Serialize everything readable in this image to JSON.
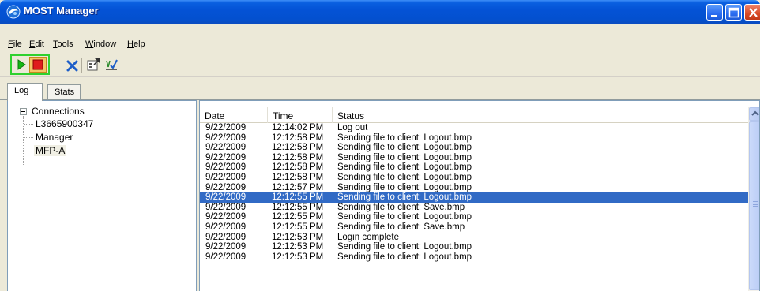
{
  "window": {
    "title": "MOST Manager"
  },
  "menu": [
    "File",
    "Edit",
    "Tools",
    "Window",
    "Help"
  ],
  "toolbar": {
    "icons": [
      "play-icon",
      "stop-icon",
      "delete-icon",
      "properties-icon",
      "checklist-icon"
    ]
  },
  "tabs": [
    {
      "label": "Log",
      "active": true
    },
    {
      "label": "Stats",
      "active": false
    }
  ],
  "tree": {
    "root": "Connections",
    "children": [
      "L3665900347",
      "Manager",
      "MFP-A"
    ]
  },
  "log": {
    "columns": [
      "Date",
      "Time",
      "Status"
    ],
    "rows": [
      {
        "date": "9/22/2009",
        "time": "12:14:02 PM",
        "status": "Log out"
      },
      {
        "date": "9/22/2009",
        "time": "12:12:58 PM",
        "status": "Sending file to client: Logout.bmp"
      },
      {
        "date": "9/22/2009",
        "time": "12:12:58 PM",
        "status": "Sending file to client: Logout.bmp"
      },
      {
        "date": "9/22/2009",
        "time": "12:12:58 PM",
        "status": "Sending file to client: Logout.bmp"
      },
      {
        "date": "9/22/2009",
        "time": "12:12:58 PM",
        "status": "Sending file to client: Logout.bmp"
      },
      {
        "date": "9/22/2009",
        "time": "12:12:58 PM",
        "status": "Sending file to client: Logout.bmp"
      },
      {
        "date": "9/22/2009",
        "time": "12:12:57 PM",
        "status": "Sending file to client: Logout.bmp"
      },
      {
        "date": "9/22/2009",
        "time": "12:12:55 PM",
        "status": "Sending file to client: Logout.bmp",
        "selected": true
      },
      {
        "date": "9/22/2009",
        "time": "12:12:55 PM",
        "status": "Sending file to client: Save.bmp"
      },
      {
        "date": "9/22/2009",
        "time": "12:12:55 PM",
        "status": "Sending file to client: Logout.bmp"
      },
      {
        "date": "9/22/2009",
        "time": "12:12:55 PM",
        "status": "Sending file to client: Save.bmp"
      },
      {
        "date": "9/22/2009",
        "time": "12:12:53 PM",
        "status": "Login complete"
      },
      {
        "date": "9/22/2009",
        "time": "12:12:53 PM",
        "status": "Sending file to client: Logout.bmp"
      },
      {
        "date": "9/22/2009",
        "time": "12:12:53 PM",
        "status": "Sending file to client: Logout.bmp"
      }
    ]
  },
  "colors": {
    "title_bar": "#0453d6",
    "selection": "#316ac5",
    "highlight_box": "#2fd12f"
  }
}
